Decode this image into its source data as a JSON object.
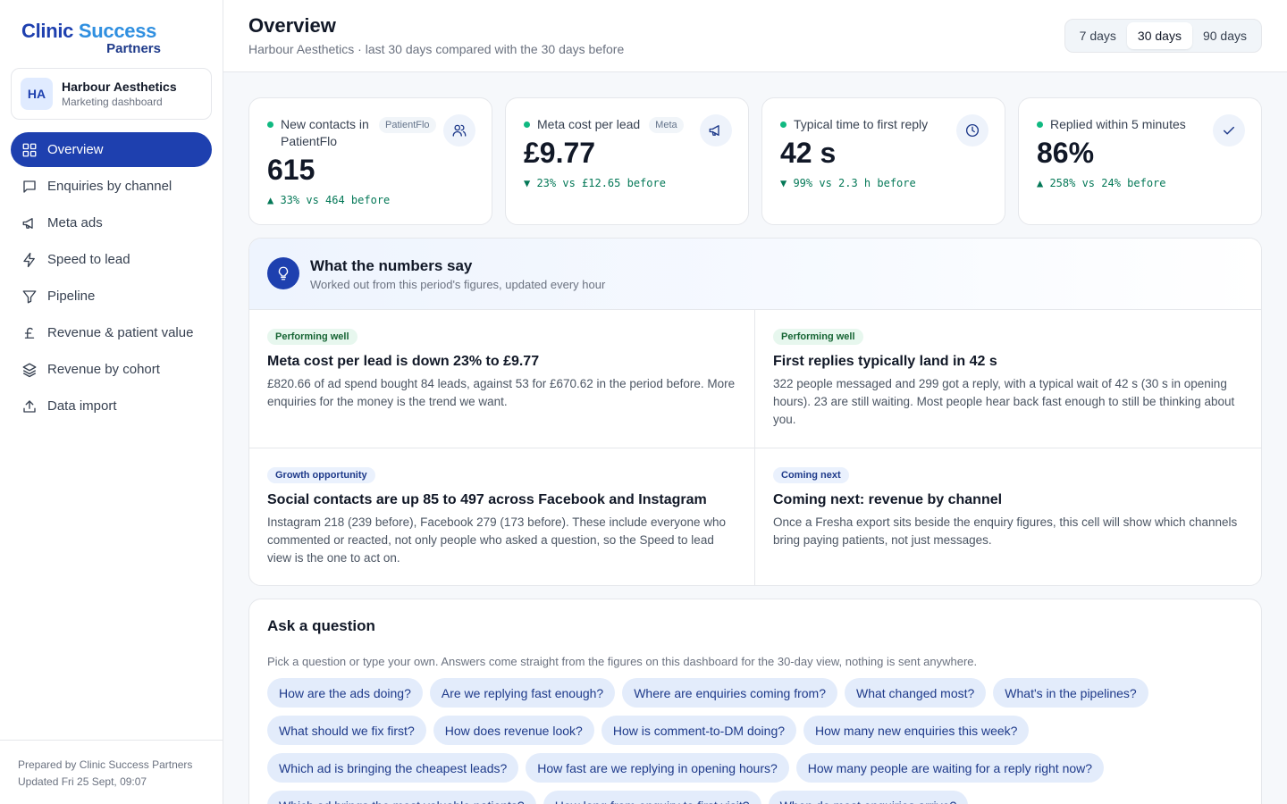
{
  "brand": {
    "line1_a": "Clinic",
    "line1_b": " Success",
    "line2": "Partners"
  },
  "account": {
    "initials": "HA",
    "name": "Harbour Aesthetics",
    "subtitle": "Marketing dashboard"
  },
  "nav": [
    {
      "label": "Overview",
      "icon": "grid-icon",
      "active": true
    },
    {
      "label": "Enquiries by channel",
      "icon": "message-icon"
    },
    {
      "label": "Meta ads",
      "icon": "megaphone-icon"
    },
    {
      "label": "Speed to lead",
      "icon": "bolt-icon"
    },
    {
      "label": "Pipeline",
      "icon": "filter-icon"
    },
    {
      "label": "Revenue & patient value",
      "icon": "pound-icon"
    },
    {
      "label": "Revenue by cohort",
      "icon": "layers-icon"
    },
    {
      "label": "Data import",
      "icon": "upload-icon"
    }
  ],
  "footer": {
    "line1": "Prepared by Clinic Success Partners",
    "line2": "Updated Fri 25 Sept, 09:07"
  },
  "header": {
    "title": "Overview",
    "subtitle": "Harbour Aesthetics · last 30 days compared with the 30 days before",
    "ranges": [
      "7 days",
      "30 days",
      "90 days"
    ],
    "selected_range": "30 days"
  },
  "kpis": [
    {
      "label": "New contacts in PatientFlo",
      "tag": "PatientFlo",
      "value": "615",
      "delta": "▲ 33% vs 464 before",
      "icon": "users-icon"
    },
    {
      "label": "Meta cost per lead",
      "tag": "Meta",
      "value": "£9.77",
      "delta": "▼ 23% vs £12.65 before",
      "icon": "megaphone-icon"
    },
    {
      "label": "Typical time to first reply",
      "tag": "",
      "value": "42 s",
      "delta": "▼ 99% vs 2.3 h before",
      "icon": "clock-icon"
    },
    {
      "label": "Replied within 5 minutes",
      "tag": "",
      "value": "86%",
      "delta": "▲ 258% vs 24% before",
      "icon": "check-icon"
    }
  ],
  "insights": {
    "title": "What the numbers say",
    "subtitle": "Worked out from this period's figures, updated every hour",
    "cards": [
      {
        "badge": "Performing well",
        "kind": "good",
        "title": "Meta cost per lead is down 23% to £9.77",
        "text": "£820.66 of ad spend bought 84 leads, against 53 for £670.62 in the period before. More enquiries for the money is the trend we want."
      },
      {
        "badge": "Performing well",
        "kind": "good",
        "title": "First replies typically land in 42 s",
        "text": "322 people messaged and 299 got a reply, with a typical wait of 42 s (30 s in opening hours). 23 are still waiting. Most people hear back fast enough to still be thinking about you."
      },
      {
        "badge": "Growth opportunity",
        "kind": "grow",
        "title": "Social contacts are up 85 to 497 across Facebook and Instagram",
        "text": "Instagram 218 (239 before), Facebook 279 (173 before). These include everyone who commented or reacted, not only people who asked a question, so the Speed to lead view is the one to act on."
      },
      {
        "badge": "Coming next",
        "kind": "grow",
        "title": "Coming next: revenue by channel",
        "text": "Once a Fresha export sits beside the enquiry figures, this cell will show which channels bring paying patients, not just messages."
      }
    ]
  },
  "ask": {
    "title": "Ask a question",
    "subtitle": "Pick a question or type your own. Answers come straight from the figures on this dashboard for the 30-day view, nothing is sent anywhere.",
    "chips": [
      "How are the ads doing?",
      "Are we replying fast enough?",
      "Where are enquiries coming from?",
      "What changed most?",
      "What's in the pipelines?",
      "What should we fix first?",
      "How does revenue look?",
      "How is comment-to-DM doing?",
      "How many new enquiries this week?",
      "Which ad is bringing the cheapest leads?",
      "How fast are we replying in opening hours?",
      "How many people are waiting for a reply right now?",
      "Which ad brings the most valuable patients?",
      "How long from enquiry to first visit?",
      "When do most enquiries arrive?"
    ]
  },
  "colors": {
    "accent": "#1e40af",
    "positive": "#047857",
    "status_dot": "#10b981"
  }
}
